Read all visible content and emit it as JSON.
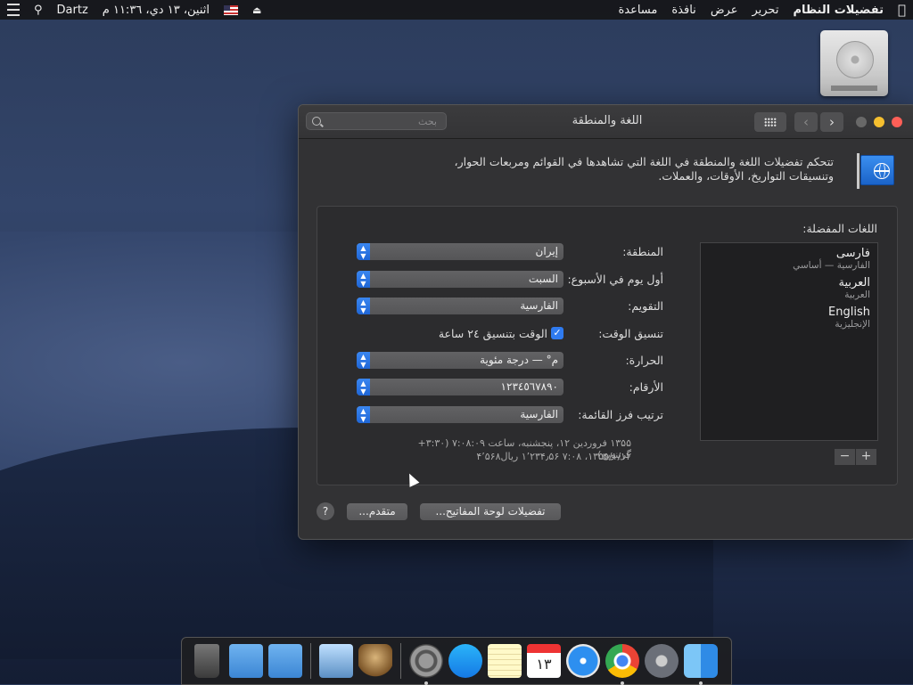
{
  "menubar": {
    "apple_icon": "apple-icon",
    "app_name": "تفضيلات النظام",
    "menus": [
      "تحرير",
      "عرض",
      "نافذة",
      "مساعدة"
    ],
    "clock": "اثنين، ١٣ دي، ١١:٣٦ م",
    "user": "Dartz"
  },
  "window": {
    "title": "اللغة والمنطقة",
    "search_placeholder": "بحث",
    "description_line1": "تتحكم تفضيلات اللغة والمنطقة في اللغة التي تشاهدها في القوائم ومربعات الحوار،",
    "description_line2": "وتنسيقات التواريخ، الأوقات، والعملات.",
    "preferred_languages_title": "اللغات المفضلة:",
    "languages": [
      {
        "name": "فارسی",
        "sub": "الفارسية — أساسي"
      },
      {
        "name": "العربية",
        "sub": "العربية"
      },
      {
        "name": "English",
        "sub": "الإنجليزية"
      }
    ],
    "add_label": "+",
    "remove_label": "−",
    "region_label": "المنطقة:",
    "region_value": "إيران",
    "first_day_label": "أول يوم في الأسبوع:",
    "first_day_value": "السبت",
    "calendar_label": "التقويم:",
    "calendar_value": "الفارسية",
    "time_format_label": "تنسيق الوقت:",
    "time_format_value": "الوقت بتنسيق ٢٤ ساعة",
    "temperature_label": "الحرارة:",
    "temperature_value": "م° — درجة مئوية",
    "numbers_label": "الأرقام:",
    "numbers_value": "١٢٣٤٥٦٧٨٩٠",
    "sort_label": "ترتيب فرز القائمة:",
    "sort_value": "الفارسية",
    "sample_line1": "۱۳۵۵ فروردین ۱۲، پنجشنبه، ساعت ۷:۰۸:۰۹ (‎+۳:۳۰ گرینویچ)",
    "sample_line2": "۱۳۵۵/۱/۱۲، ۷:۰۸     ۱٬۲۳۴٫۵۶     ریال۴٬۵۶۸",
    "keyboard_button": "تفضيلات لوحة المفاتيح...",
    "advanced_button": "متقدم...",
    "help_label": "?"
  },
  "dock": {
    "items": [
      "finder",
      "launchpad",
      "chrome",
      "safari",
      "calendar",
      "notes",
      "app-store",
      "system-preferences",
      "chess",
      "preview",
      "applications-folder",
      "downloads-folder",
      "trash"
    ],
    "calendar_day": "١٣"
  }
}
